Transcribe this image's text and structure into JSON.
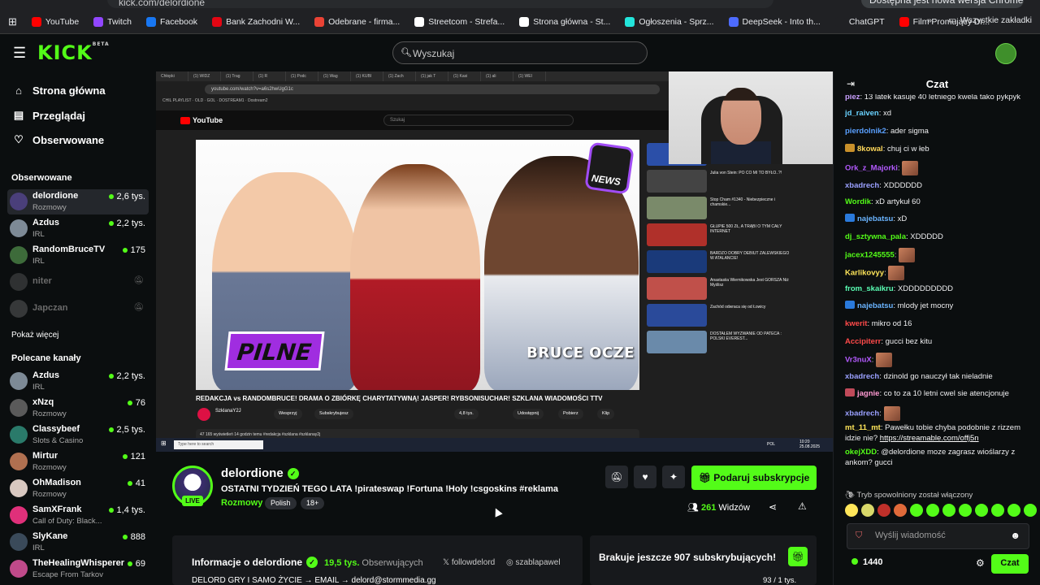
{
  "browser": {
    "url": "kick.com/delordione",
    "update_notice": "Dostępna jest nowa wersja Chrome",
    "bookmarks": [
      {
        "label": "YouTube",
        "color": "#ff0000"
      },
      {
        "label": "Twitch",
        "color": "#9146ff"
      },
      {
        "label": "Facebook",
        "color": "#1877f2"
      },
      {
        "label": "Bank Zachodni W...",
        "color": "#e30613"
      },
      {
        "label": "Odebrane - firma...",
        "color": "#ea4335"
      },
      {
        "label": "Streetcom - Strefa...",
        "color": "#ffffff"
      },
      {
        "label": "Strona główna - St...",
        "color": "#ffffff"
      },
      {
        "label": "Ogłoszenia - Sprz...",
        "color": "#23e5db"
      },
      {
        "label": "DeepSeek - Into th...",
        "color": "#4d6bfe"
      },
      {
        "label": "ChatGPT",
        "color": "#202124"
      },
      {
        "label": "Film Promujący Dr...",
        "color": "#ff0000"
      }
    ],
    "all_bookmarks": "Wszystkie zakładki"
  },
  "header": {
    "logo": "KICK",
    "logo_beta": "BETA",
    "search_placeholder": "Wyszukaj"
  },
  "nav": {
    "home": "Strona główna",
    "browse": "Przeglądaj",
    "following": "Obserwowane"
  },
  "followed": {
    "title": "Obserwowane",
    "channels": [
      {
        "name": "delordione",
        "category": "Rozmowy",
        "viewers": "2,6 tys.",
        "avatar": "#4a3f7a",
        "live": true
      },
      {
        "name": "Azdus",
        "category": "IRL",
        "viewers": "2,2 tys.",
        "avatar": "#7d8a96",
        "live": true
      },
      {
        "name": "RandomBruceTV",
        "category": "IRL",
        "viewers": "175",
        "avatar": "#3d6b3a",
        "live": true
      },
      {
        "name": "niter",
        "category": "",
        "viewers": "",
        "avatar": "#666666",
        "live": false
      },
      {
        "name": "Japczan",
        "category": "",
        "viewers": "",
        "avatar": "#777777",
        "live": false
      }
    ],
    "show_more": "Pokaż więcej"
  },
  "recommended": {
    "title": "Polecane kanały",
    "channels": [
      {
        "name": "Azdus",
        "category": "IRL",
        "viewers": "2,2 tys.",
        "avatar": "#7d8a96"
      },
      {
        "name": "xNzq",
        "category": "Rozmowy",
        "viewers": "76",
        "avatar": "#5a5a5a"
      },
      {
        "name": "Classybeef",
        "category": "Slots & Casino",
        "viewers": "2,5 tys.",
        "avatar": "#2a7a6a"
      },
      {
        "name": "Mirtur",
        "category": "Rozmowy",
        "viewers": "121",
        "avatar": "#b07050"
      },
      {
        "name": "OhMadison",
        "category": "Rozmowy",
        "viewers": "41",
        "avatar": "#d8c8c0"
      },
      {
        "name": "SamXFrank",
        "category": "Call of Duty: Black...",
        "viewers": "1,4 tys.",
        "avatar": "#e0307a"
      },
      {
        "name": "SlyKane",
        "category": "IRL",
        "viewers": "888",
        "avatar": "#3a4a5a"
      },
      {
        "name": "TheHealingWhisperer",
        "category": "Escape From Tarkov",
        "viewers": "69",
        "avatar": "#c04a8a"
      }
    ]
  },
  "video": {
    "yt_logo": "YouTube",
    "yt_url": "youtube.com/watch?v=a6s2hwUgG1c",
    "yt_search": "Szukaj",
    "thumb_badge": "NEWS",
    "thumb_pilne": "PILNE",
    "thumb_bruce": "BRUCE OCZE",
    "yt_title": "REDAKCJA vs RANDOMBRUCE! DRAMA O ZBIÓRKĘ CHARYTATYWNĄ! JASPER! RYBSONISUCHAR! SZKLANA WIADOMOŚCI TTV",
    "yt_channel": "SzklanaY2J",
    "yt_subscribed": "Subskrybujesz",
    "yt_joined": "Wesprzyj",
    "yt_likes": "4,8 tys.",
    "yt_share": "Udostępnij",
    "yt_download": "Pobierz",
    "yt_clip": "Klip",
    "yt_desc": "47 165 wyświetleń  14 godzin temu  #redakcja #szklana #szklanay2j",
    "taskbar_search": "Type here to search",
    "taskbar_time": "10:20",
    "taskbar_date": "25.08.2025",
    "taskbar_lang": "POL",
    "side_videos": [
      {
        "text": "LEWY WRÓCIŁ, MBAPPE...",
        "color": "#2b4fa8"
      },
      {
        "text": "Julia von Stein: PO CO MI TO BYŁO..?!",
        "color": "#444444"
      },
      {
        "text": "Stop Cham #1340 - Niebezpieczne i chamskie...",
        "color": "#7a8a6a"
      },
      {
        "text": "GŁUPIE 500 ZŁ, A TRĄBI O TYM CAŁY INTERNET",
        "color": "#b0302a"
      },
      {
        "text": "BARDZO DOBRY DEBIUT ZALEWSKIEGO W ATALANCIE!",
        "color": "#1a3a7a"
      },
      {
        "text": "Anastasiia Wiernikowska Jest GORSZA Niż Myślisz",
        "color": "#c0504a"
      },
      {
        "text": "Zachód odwraca się od Łowicy",
        "color": "#2a4a9a"
      },
      {
        "text": "DOSTAŁEM WYZWANIE OD PATECA : POLSKI EVEREST...",
        "color": "#6a8aaa"
      }
    ]
  },
  "stream": {
    "streamer": "delordione",
    "live_label": "LIVE",
    "title": "OSTATNI TYDZIEŃ TEGO LATA !pirateswap !Fortuna !Holy !csgoskins  #reklama",
    "category": "Rozmowy",
    "tags": [
      "Polish",
      "18+"
    ],
    "subscribe_label": "Podaruj subskrypcje",
    "viewers": "261",
    "viewers_label": "Widzów"
  },
  "about": {
    "title": "Informacje o delordione",
    "followers": "19,5 tys.",
    "followers_label": "Obserwujących",
    "twitter": "followdelord",
    "instagram": "szablapawel",
    "description": "DELORD GRY I SAMO ŻYCIE → EMAIL → delord@stormmedia.gg"
  },
  "goal": {
    "title": "Brakuje jeszcze 907 subskrybujących!",
    "count": "93 / 1 tys."
  },
  "chat": {
    "title": "Czat",
    "messages": [
      {
        "user": "piez",
        "color": "#c9a0ff",
        "text": "13 latek kasuje 40 letniego kwela tako pykpyk",
        "badge": ""
      },
      {
        "user": "jd_raiven",
        "color": "#69d2ff",
        "text": "xd",
        "badge": ""
      },
      {
        "user": "pierdolnik2",
        "color": "#5aa0ff",
        "text": "ader sigma",
        "badge": ""
      },
      {
        "user": "8kowal",
        "color": "#ffd85a",
        "text": "chuj ci w łeb",
        "badge": "#c8902a"
      },
      {
        "user": "Ork_z_Majorki",
        "color": "#b45aff",
        "text": "",
        "badge": "",
        "emote": true
      },
      {
        "user": "xbadrech",
        "color": "#9aa0ff",
        "text": "XDDDDDD",
        "badge": ""
      },
      {
        "user": "Wordik",
        "color": "#53fc18",
        "text": "xD artykuł 60",
        "badge": ""
      },
      {
        "user": "najebatsu",
        "color": "#6ab4ff",
        "text": "xD",
        "badge": "#2a7adc"
      },
      {
        "user": "dj_sztywna_pala",
        "color": "#53fc18",
        "text": "XDDDDD",
        "badge": ""
      },
      {
        "user": "jacex1245555",
        "color": "#53fc18",
        "text": "",
        "badge": "",
        "emote": true
      },
      {
        "user": "Karlikovyy",
        "color": "#ffe65a",
        "text": "",
        "badge": "",
        "emote": true
      },
      {
        "user": "from_skaikru",
        "color": "#5affb4",
        "text": "XDDDDDDDDD",
        "badge": ""
      },
      {
        "user": "najebatsu",
        "color": "#6ab4ff",
        "text": "mlody jet mocny",
        "badge": "#2a7adc"
      },
      {
        "user": "kwerit",
        "color": "#ff4a4a",
        "text": "mikro od 16",
        "badge": ""
      },
      {
        "user": "Accipiterr",
        "color": "#ff4a4a",
        "text": "gucci bez kitu",
        "badge": ""
      },
      {
        "user": "Vr3nuX",
        "color": "#b45aff",
        "text": "",
        "badge": "",
        "emote": true
      },
      {
        "user": "xbadrech",
        "color": "#9aa0ff",
        "text": "dzinold go nauczył tak nieladnie",
        "badge": ""
      },
      {
        "user": "jagnie",
        "color": "#ff9ad2",
        "text": "co to za 10 letni cwel sie atencjonuje",
        "badge": "#c04a5a"
      },
      {
        "user": "xbadrech",
        "color": "#9aa0ff",
        "text": "",
        "badge": "",
        "emote": true
      },
      {
        "user": "mt_11_mt",
        "color": "#ffe65a",
        "text": "Pawełku tobie chyba podobnie z rizzem idzie nie? ",
        "badge": "",
        "link": "https://streamable.com/offj5n"
      },
      {
        "user": "okejXDD",
        "color": "#53fc18",
        "text": "@delordione moze zagrasz wioślarzy z ankom? gucci",
        "badge": ""
      }
    ],
    "slow_mode": "Tryb spowolniony został włączony",
    "emote_colors": [
      "#ffe65a",
      "#d8d86a",
      "#c0302a",
      "#e06a3a",
      "#53fc18",
      "#53fc18",
      "#53fc18",
      "#53fc18",
      "#53fc18",
      "#53fc18",
      "#53fc18",
      "#53fc18"
    ],
    "input_placeholder": "Wyślij wiadomość",
    "points": "1440",
    "send_label": "Czat"
  }
}
